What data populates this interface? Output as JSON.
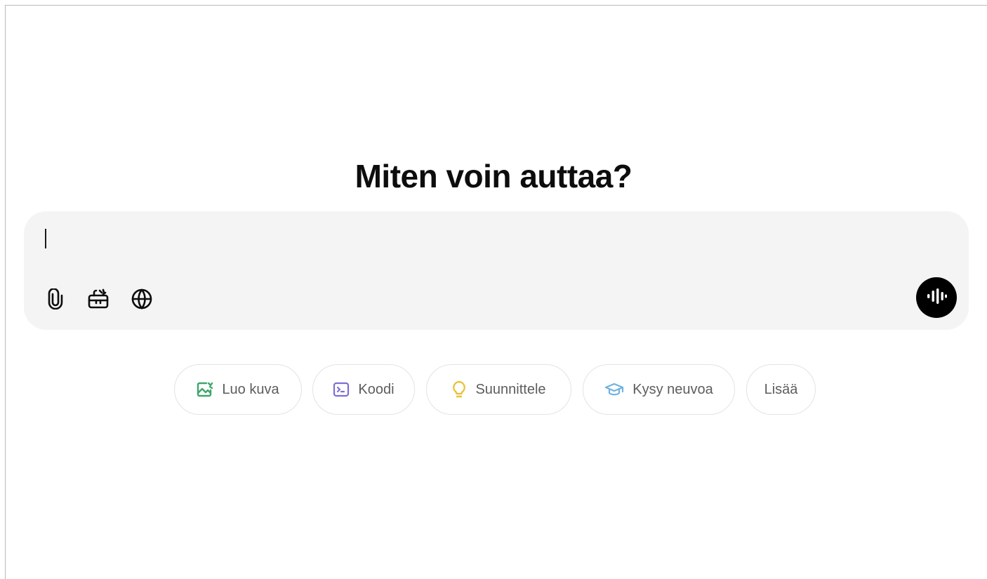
{
  "main": {
    "heading": "Miten voin auttaa?"
  },
  "composer": {
    "input_value": "",
    "tools": [
      {
        "icon": "paperclip-icon"
      },
      {
        "icon": "toolbox-icon"
      },
      {
        "icon": "globe-icon"
      }
    ],
    "voice_icon": "voice-waveform-icon"
  },
  "suggestions": [
    {
      "label": "Luo kuva",
      "icon": "image-icon",
      "color": "#3fa66b"
    },
    {
      "label": "Koodi",
      "icon": "terminal-icon",
      "color": "#7c6fd4"
    },
    {
      "label": "Suunnittele",
      "icon": "lightbulb-icon",
      "color": "#e8c23a"
    },
    {
      "label": "Kysy neuvoa",
      "icon": "graduation-cap-icon",
      "color": "#6fb3e0"
    },
    {
      "label": "Lisää"
    }
  ],
  "colors": {
    "composer_bg": "#f4f4f4",
    "voice_button_bg": "#000000"
  }
}
